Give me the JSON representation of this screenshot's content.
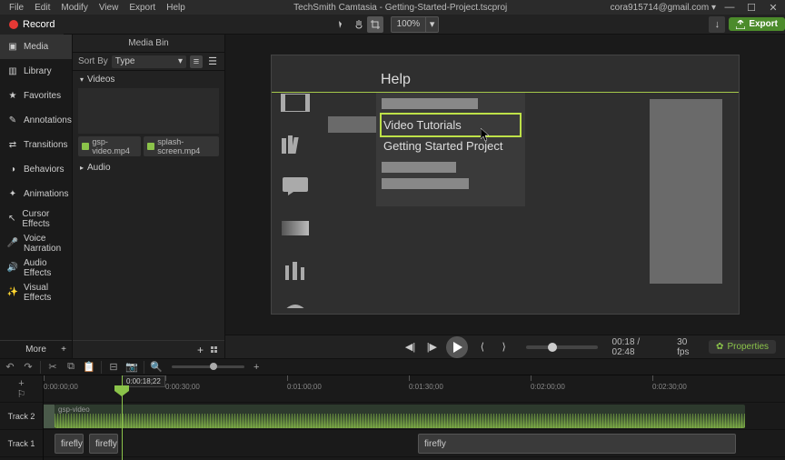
{
  "titlebar": {
    "menus": [
      "File",
      "Edit",
      "Modify",
      "View",
      "Export",
      "Help"
    ],
    "title": "TechSmith Camtasia - Getting-Started-Project.tscproj",
    "user_email": "cora915714@gmail.com",
    "user_caret": "▾"
  },
  "recordbar": {
    "record_label": "Record",
    "zoom_value": "100%",
    "export_label": "Export"
  },
  "sidebar": {
    "items": [
      {
        "label": "Media",
        "icon": "media-icon"
      },
      {
        "label": "Library",
        "icon": "library-icon"
      },
      {
        "label": "Favorites",
        "icon": "star-icon"
      },
      {
        "label": "Annotations",
        "icon": "annotations-icon"
      },
      {
        "label": "Transitions",
        "icon": "transitions-icon"
      },
      {
        "label": "Behaviors",
        "icon": "behaviors-icon"
      },
      {
        "label": "Animations",
        "icon": "animations-icon"
      },
      {
        "label": "Cursor Effects",
        "icon": "cursor-icon"
      },
      {
        "label": "Voice Narration",
        "icon": "mic-icon"
      },
      {
        "label": "Audio Effects",
        "icon": "audio-icon"
      },
      {
        "label": "Visual Effects",
        "icon": "visual-icon"
      }
    ],
    "more_label": "More",
    "plus": "+"
  },
  "mediabin": {
    "title": "Media Bin",
    "sort_by_label": "Sort By",
    "type_label": "Type",
    "folders": [
      {
        "name": "Videos",
        "open": true
      },
      {
        "name": "Audio",
        "open": false
      }
    ],
    "files": [
      "gsp-video.mp4",
      "splash-screen.mp4"
    ],
    "plus": "+"
  },
  "canvas": {
    "help_title": "Help",
    "menu_items": [
      "Video Tutorials",
      "Getting Started Project"
    ]
  },
  "playbar": {
    "time": "00:18 / 02:48",
    "fps": "30 fps",
    "properties_label": "Properties"
  },
  "timeline": {
    "playhead_time": "0:00:18;22",
    "ticks": [
      "0:00:00;00",
      "0:00:30;00",
      "0:01:00;00",
      "0:01:30;00",
      "0:02:00;00",
      "0:02:30;00"
    ],
    "tracks": [
      {
        "name": "Track 2"
      },
      {
        "name": "Track 1"
      }
    ],
    "video_clip_label": "gsp-video",
    "annotation_clips": [
      "firefly",
      "firefly",
      "firefly"
    ],
    "zoom_plus": "+"
  },
  "colors": {
    "accent": "#8bc34a",
    "highlight": "#bde048"
  }
}
